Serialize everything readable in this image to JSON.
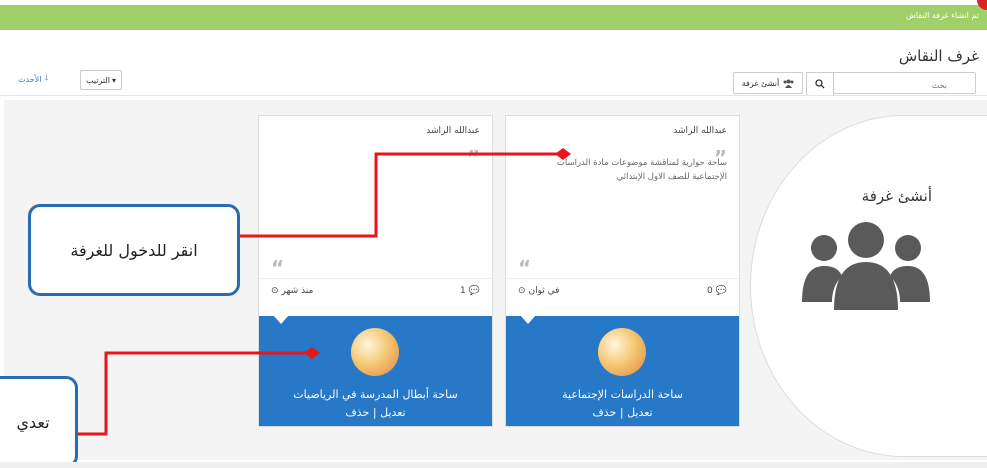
{
  "banner": {
    "text": "تم انشاء غرفة النقاش"
  },
  "page": {
    "title": "غرف النقاش"
  },
  "toolbar": {
    "search_placeholder": "بحث",
    "create_room_label": "أنشئ غرفة",
    "sort_label": "الترتيب",
    "newest_label": "الأحدث"
  },
  "create_card": {
    "label": "أنشئ غرفة",
    "icon": "group-icon"
  },
  "rooms": [
    {
      "author": "عبدالله الراشد",
      "description": "ساحة حوارية لمناقشة موضوعات مادة الدراسات الإجتماعية للصف الاول الإبتدائي",
      "time": "في ثوان",
      "comments": "0",
      "title": "ساحة الدراسات الإجتماعية",
      "edit_label": "تعديل",
      "separator": "|",
      "delete_label": "حذف"
    },
    {
      "author": "عبدالله الراشد",
      "description": "",
      "time": "منذ شهر",
      "comments": "1",
      "title": "ساحة أبطال المدرسة في الرياضيات",
      "edit_label": "تعديل",
      "separator": "|",
      "delete_label": "حذف"
    }
  ],
  "callouts": {
    "enter_room": "انقر للدخول للغرفة",
    "edit": "تعدي"
  },
  "colors": {
    "banner": "#a1cf6a",
    "card_blue": "#2878c8",
    "arrow": "#e8151b",
    "callout_border": "#2a6cb0"
  }
}
